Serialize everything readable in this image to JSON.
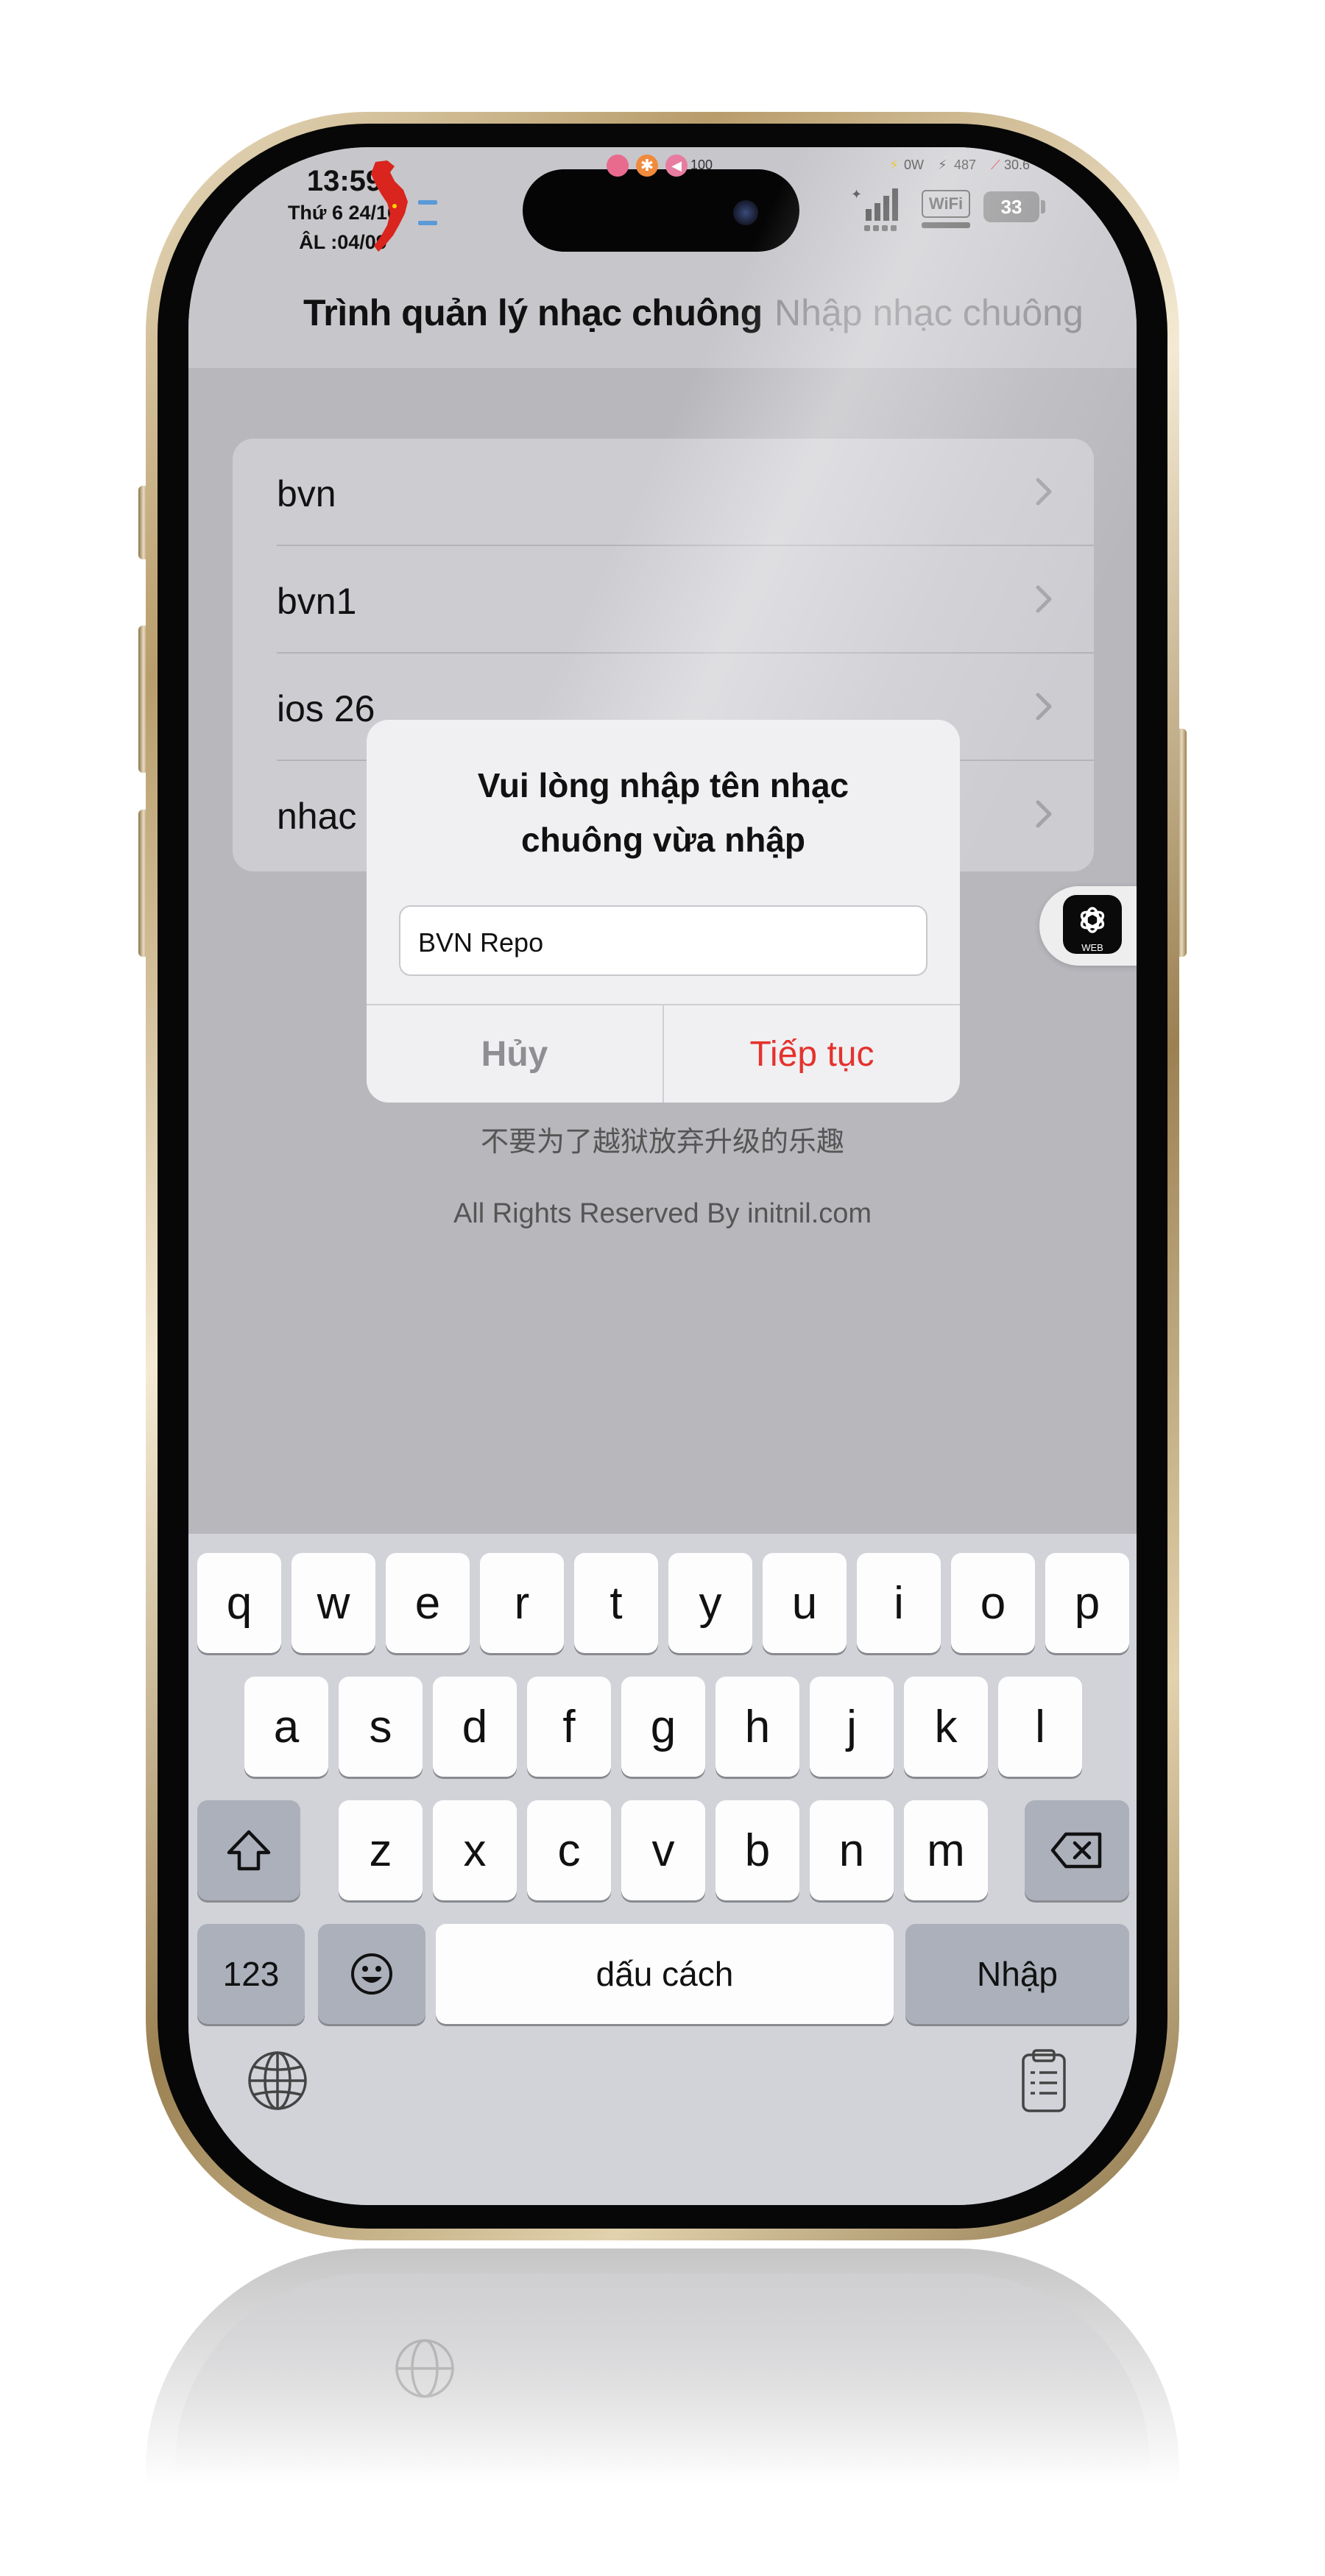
{
  "status_bar": {
    "time": "13:59",
    "date": "Thứ 6 24/10",
    "lunar_date": "ÂL :04/09",
    "volume_value": "100",
    "power_draw": "0W",
    "charge_value": "487",
    "temperature": "30.6°",
    "wifi_label": "WiFi",
    "battery_level": "33"
  },
  "nav": {
    "title": "Trình quản lý nhạc chuông",
    "secondary_title": "Nhập nhạc chuông"
  },
  "list": {
    "items": [
      {
        "label": "bvn"
      },
      {
        "label": "bvn1"
      },
      {
        "label": "ios 26"
      },
      {
        "label": "nhac"
      }
    ]
  },
  "alert": {
    "title_line1": "Vui lòng nhập tên nhạc",
    "title_line2": "chuông vừa nhập",
    "input_value": "BVN Repo",
    "cancel_label": "Hủy",
    "continue_label": "Tiếp tục"
  },
  "footer": {
    "chinese_text": "不要为了越狱放弃升级的乐趣",
    "rights_text": "All Rights Reserved By initnil.com"
  },
  "floating_button": {
    "label": "WEB"
  },
  "keyboard": {
    "row1": [
      "q",
      "w",
      "e",
      "r",
      "t",
      "y",
      "u",
      "i",
      "o",
      "p"
    ],
    "row2": [
      "a",
      "s",
      "d",
      "f",
      "g",
      "h",
      "j",
      "k",
      "l"
    ],
    "row3": [
      "z",
      "x",
      "c",
      "v",
      "b",
      "n",
      "m"
    ],
    "numbers_label": "123",
    "space_label": "dấu cách",
    "return_label": "Nhập"
  },
  "colors": {
    "accent_red": "#e5322d",
    "cancel_gray": "#8e8e93"
  }
}
